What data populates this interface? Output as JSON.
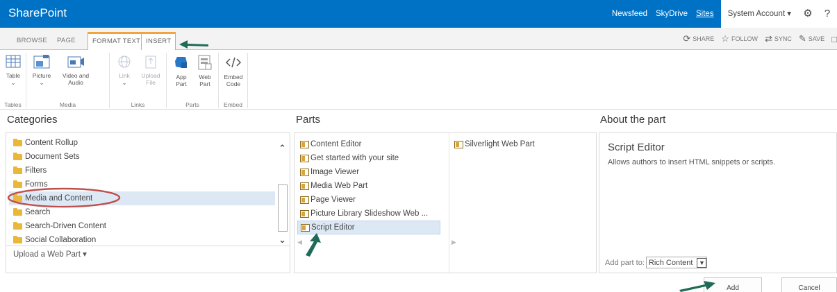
{
  "suite": {
    "brand": "SharePoint",
    "links": [
      "Newsfeed",
      "SkyDrive",
      "Sites"
    ],
    "account": "System Account ▾",
    "help": "?"
  },
  "tabs": [
    "BROWSE",
    "PAGE",
    "FORMAT TEXT",
    "INSERT"
  ],
  "actions": [
    "SHARE",
    "FOLLOW",
    "SYNC",
    "SAVE"
  ],
  "ribbon": {
    "table": "Table",
    "picture": "Picture",
    "video": "Video and Audio",
    "link": "Link",
    "upload": "Upload File",
    "app_part": "App Part",
    "web_part": "Web Part",
    "embed": "Embed Code",
    "groups": [
      "Tables",
      "Media",
      "Links",
      "Parts",
      "Embed"
    ]
  },
  "categories": {
    "header": "Categories",
    "items": [
      "Content Rollup",
      "Document Sets",
      "Filters",
      "Forms",
      "Media and Content",
      "Search",
      "Search-Driven Content",
      "Social Collaboration"
    ],
    "selected": "Media and Content",
    "upload": "Upload a Web Part ▾"
  },
  "parts": {
    "header": "Parts",
    "col1": [
      "Content Editor",
      "Get started with your site",
      "Image Viewer",
      "Media Web Part",
      "Page Viewer",
      "Picture Library Slideshow Web ...",
      "Script Editor"
    ],
    "col2": [
      "Silverlight Web Part"
    ],
    "selected": "Script Editor"
  },
  "about": {
    "header": "About the part",
    "title": "Script Editor",
    "description": "Allows authors to insert HTML snippets or scripts.",
    "add_to_label": "Add part to:",
    "add_to_value": "Rich Content"
  },
  "buttons": {
    "add": "Add",
    "cancel": "Cancel"
  },
  "colors": {
    "suitebar": "#0072c6",
    "context_tab": "#f0a540",
    "annotation": "#1f6b57",
    "circle": "#c0504d"
  }
}
